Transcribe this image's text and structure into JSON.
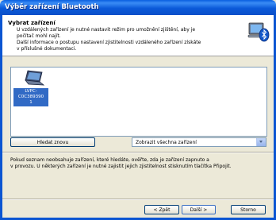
{
  "window": {
    "title": "Výběr zařízení Bluetooth"
  },
  "header": {
    "heading": "Vybrat zařízení",
    "lines": [
      "U vzdálených zařízení je nutné nastavit režim pro umožnění zjištění, aby je",
      "počítač mohl najít.",
      "Další informace o postupu nastavení zjistitelnosti vzdáleného zařízení získáte",
      "v příslušné dokumentaci."
    ],
    "icon": "bluetooth-computer-icon"
  },
  "device_list": {
    "items": [
      {
        "label_line1": "LVPC-C0C389390",
        "label_line2": "1",
        "icon": "laptop-icon",
        "selected": true
      }
    ]
  },
  "controls": {
    "search_label": "Hledat znovu",
    "filter_value": "Zobrazit všechna zařízení"
  },
  "info": {
    "lines": [
      "Pokud seznam neobsahuje zařízení, které hledáte, ověřte, zda je zařízení zapnuto a",
      "v provozu. U některých zařízení je nutné zajistit jejich zjistitelnost stisknutím tlačítka Připojit."
    ]
  },
  "footer": {
    "back_label": "< Zpět",
    "next_label": "Další >",
    "cancel_label": "Storno"
  }
}
